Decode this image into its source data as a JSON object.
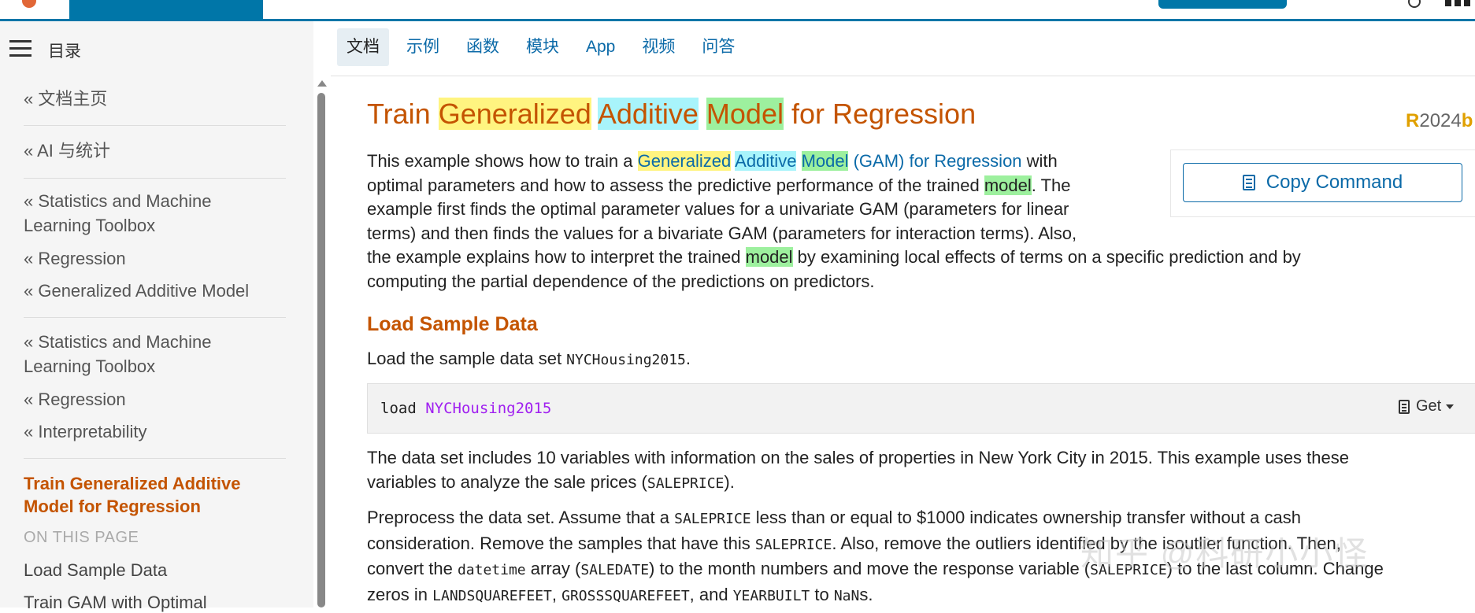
{
  "toc": {
    "title": "目录"
  },
  "nav": {
    "links": [
      {
        "label": "« 文档主页"
      },
      {
        "label": "« AI 与统计"
      },
      {
        "label": "« Statistics and Machine Learning Toolbox"
      },
      {
        "label": "« Regression"
      },
      {
        "label": "« Generalized Additive Model"
      },
      {
        "label": "« Statistics and Machine Learning Toolbox"
      },
      {
        "label": "« Regression"
      },
      {
        "label": "« Interpretability"
      }
    ],
    "current": "Train Generalized Additive Model for Regression",
    "on_this_page": "ON THIS PAGE",
    "otp_links": [
      "Load Sample Data",
      "Train GAM with Optimal"
    ]
  },
  "tabs": [
    "文档",
    "示例",
    "函数",
    "模块",
    "App",
    "视频",
    "问答"
  ],
  "page": {
    "title_parts": [
      "Train ",
      "Generalized",
      " ",
      "Additive",
      " ",
      "Model",
      " for Regression"
    ],
    "release": {
      "r": "R",
      "year": "2024",
      "b": "b"
    },
    "intro": {
      "t1": "This example shows how to train a ",
      "l1": "Generalized",
      "l2": "Additive",
      "l3": "Model",
      "l4": " (GAM) for Regression",
      "t2": " with",
      "t3": "optimal parameters and how to assess the predictive performance of the trained ",
      "m1": "model",
      "t4": ". The",
      "t5": "example first finds the optimal parameter values for a univariate GAM (parameters for linear",
      "t6": "terms) and then finds the values for a bivariate GAM (parameters for interaction terms). Also,",
      "t7": "the example explains how to interpret the trained ",
      "m2": "model",
      "t8": " by examining local effects of terms on a specific prediction and by",
      "t9": "computing the partial dependence of the predictions on predictors."
    },
    "copy_command": "Copy Command",
    "section_title": "Load Sample Data",
    "load_text": "Load the sample data set ",
    "load_code": "NYCHousing2015",
    "load_end": ".",
    "code": {
      "kw": "load ",
      "arg": "NYCHousing2015"
    },
    "get_label": "Get",
    "p2": {
      "t1": "The data set includes 10 variables with information on the sales of properties in New York City in 2015. This example uses these",
      "t2": "variables to analyze the sale prices (",
      "c1": "SALEPRICE",
      "t3": ")."
    },
    "p3": {
      "a1": "Preprocess the data set. Assume that a ",
      "c1": "SALEPRICE",
      "a2": " less than or equal to $1000 indicates ownership transfer without a cash",
      "b1": "consideration. Remove the samples that have this ",
      "c2": "SALEPRICE",
      "b2": ". Also, remove the outliers identified by the isoutlier function. Then,",
      "d1": "convert the ",
      "c3": "datetime",
      "d2": " array (",
      "c4": "SALEDATE",
      "d3": ") to the month numbers and move the response variable (",
      "c5": "SALEPRICE",
      "d4": ") to the last column. Change",
      "e1": "zeros in ",
      "c6": "LANDSQUAREFEET",
      "e2": ", ",
      "c7": "GROSSSQUAREFEET",
      "e3": ", and ",
      "c8": "YEARBUILT",
      "e4": " to ",
      "c9": "NaN",
      "e5": "s."
    },
    "watermark": "知乎 @科研小小怪"
  },
  "colors": {
    "accent": "#0076a8",
    "title": "#c45400",
    "link": "#0b6aa8"
  }
}
